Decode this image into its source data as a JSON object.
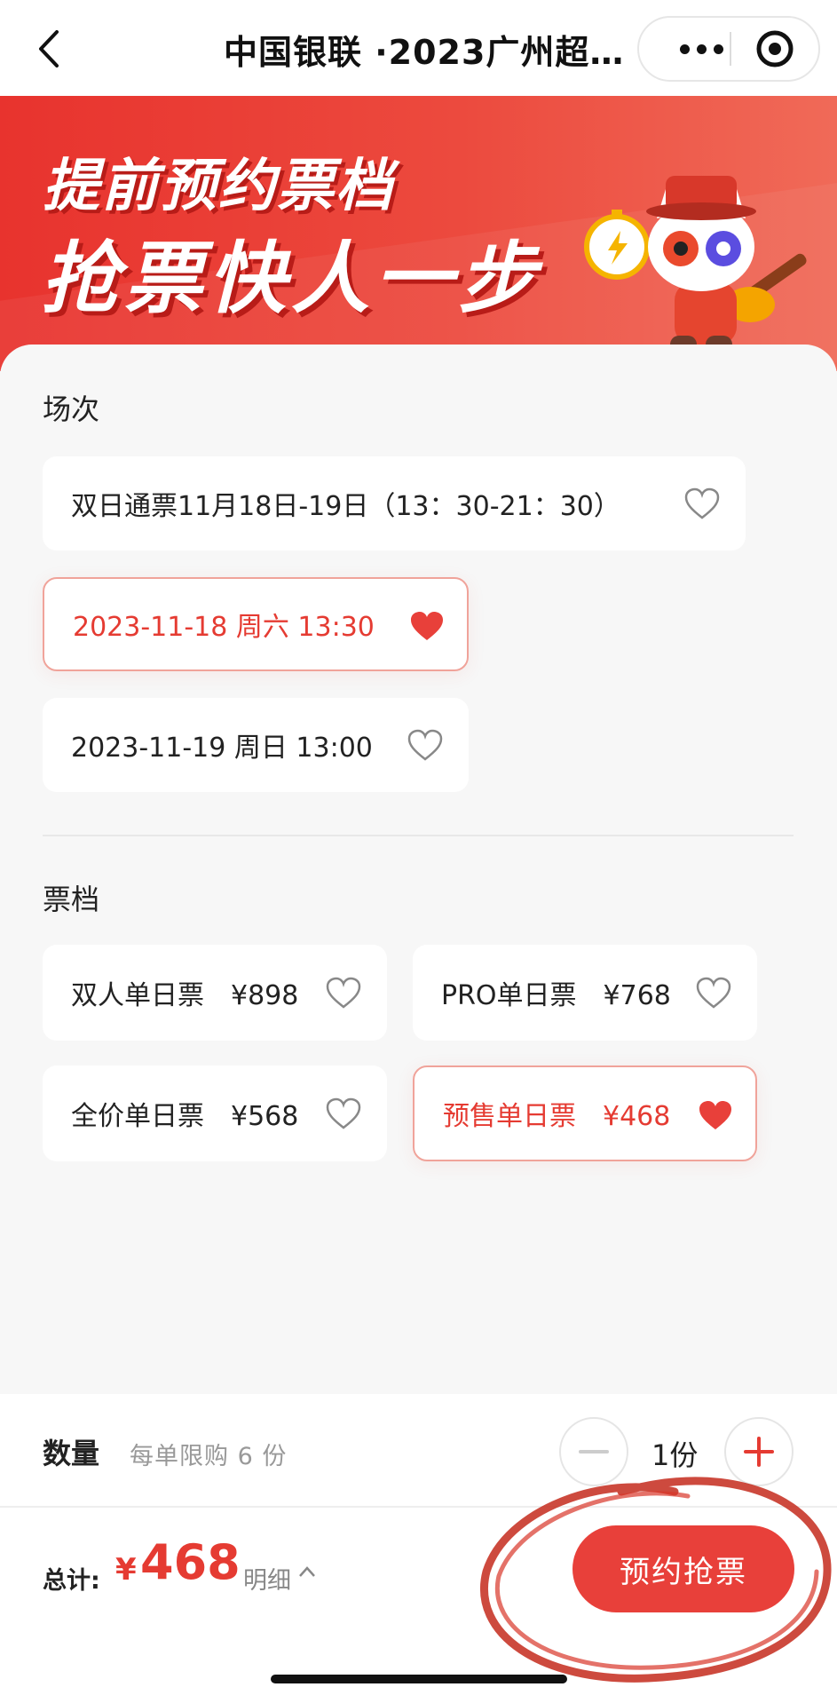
{
  "nav": {
    "title": "中国银联 ·2023广州超…"
  },
  "banner": {
    "line1": "提前预约票档",
    "line2": "抢票快人一步"
  },
  "sessions": {
    "title": "场次",
    "items": [
      {
        "label": "双日通票11月18日-19日（13：30-21：30）",
        "selected": false
      },
      {
        "label": "2023-11-18 周六 13:30",
        "selected": true
      },
      {
        "label": "2023-11-19 周日 13:00",
        "selected": false
      }
    ]
  },
  "tiers": {
    "title": "票档",
    "items": [
      {
        "label": "双人单日票　¥898",
        "selected": false
      },
      {
        "label": "PRO单日票　¥768",
        "selected": false
      },
      {
        "label": "全价单日票　¥568",
        "selected": false
      },
      {
        "label": "预售单日票　¥468",
        "selected": true
      }
    ]
  },
  "quantity": {
    "label": "数量",
    "note": "每单限购 6 份",
    "value": "1份"
  },
  "total": {
    "label": "总计:",
    "currency": "¥",
    "amount": "468",
    "detail": "明细"
  },
  "reserve_label": "预约抢票",
  "colors": {
    "accent": "#e8403a",
    "banner": "#e8332e"
  }
}
